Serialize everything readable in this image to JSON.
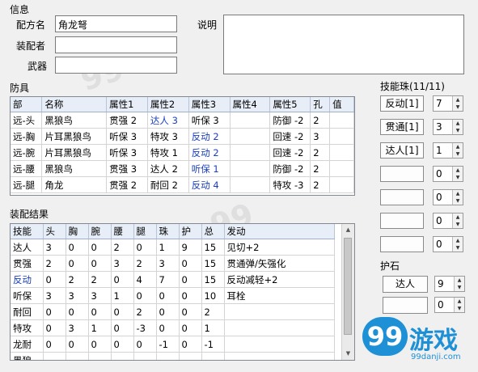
{
  "info": {
    "section_label": "信息",
    "recipe_name_label": "配方名",
    "recipe_name_value": "角龙弩",
    "assembler_label": "装配者",
    "assembler_value": "",
    "weapon_label": "武器",
    "weapon_value": "",
    "description_label": "说明",
    "description_value": ""
  },
  "armor": {
    "section_label": "防具",
    "columns": [
      "部",
      "名称",
      "属性1",
      "属性2",
      "属性3",
      "属性4",
      "属性5",
      "孔",
      "值"
    ],
    "rows": [
      [
        "远-头",
        "黑狼鸟",
        "贯强 2",
        "达人 3",
        "听保 3",
        "",
        "防御 -2",
        "2",
        ""
      ],
      [
        "远-胸",
        "片耳黑狼鸟",
        "听保 3",
        "特攻 3",
        "反动 2",
        "",
        "回速 -2",
        "3",
        ""
      ],
      [
        "远-腕",
        "片耳黑狼鸟",
        "听保 3",
        "特攻 1",
        "反动 2",
        "",
        "回速 -2",
        "2",
        ""
      ],
      [
        "远-腰",
        "黑狼鸟",
        "贯强 3",
        "达人 2",
        "听保 1",
        "",
        "防御 -2",
        "2",
        ""
      ],
      [
        "远-腿",
        "角龙",
        "贯强 2",
        "耐回 2",
        "反动 4",
        "",
        "特攻 -3",
        "2",
        ""
      ]
    ],
    "blue_cells": [
      [
        0,
        3
      ],
      [
        1,
        4
      ],
      [
        2,
        4
      ],
      [
        3,
        4
      ],
      [
        4,
        4
      ]
    ]
  },
  "result": {
    "section_label": "装配结果",
    "columns": [
      "技能",
      "头",
      "胸",
      "腕",
      "腰",
      "腿",
      "珠",
      "护",
      "总",
      "发动"
    ],
    "rows": [
      [
        "达人",
        "3",
        "0",
        "0",
        "2",
        "0",
        "1",
        "9",
        "15",
        "见切+2"
      ],
      [
        "贯强",
        "2",
        "0",
        "0",
        "3",
        "2",
        "3",
        "0",
        "15",
        "贯通弹/矢强化"
      ],
      [
        "反动",
        "0",
        "2",
        "2",
        "0",
        "4",
        "7",
        "0",
        "15",
        "反动减轻+2"
      ],
      [
        "听保",
        "3",
        "3",
        "3",
        "1",
        "0",
        "0",
        "0",
        "10",
        "耳栓"
      ],
      [
        "耐回",
        "0",
        "0",
        "0",
        "0",
        "2",
        "0",
        "0",
        "2",
        ""
      ],
      [
        "特攻",
        "0",
        "3",
        "1",
        "0",
        "-3",
        "0",
        "0",
        "1",
        ""
      ],
      [
        "龙耐",
        "0",
        "0",
        "0",
        "0",
        "0",
        "-1",
        "0",
        "-1",
        ""
      ],
      [
        "黑狼",
        "",
        "",
        "",
        "",
        "",
        "",
        "",
        "",
        ""
      ]
    ],
    "blue_rows": [
      2
    ]
  },
  "jewels": {
    "section_label": "技能珠(11/11)",
    "items": [
      {
        "label": "反动[1]",
        "count": "7"
      },
      {
        "label": "贯通[1]",
        "count": "3"
      },
      {
        "label": "达人[1]",
        "count": "1"
      },
      {
        "label": "",
        "count": "0"
      },
      {
        "label": "",
        "count": "0"
      },
      {
        "label": "",
        "count": "0"
      },
      {
        "label": "",
        "count": "0"
      }
    ]
  },
  "charm": {
    "section_label": "护石",
    "skill1_label": "达人",
    "skill1_count": "9",
    "skill2_label": "",
    "skill2_count": "0"
  },
  "watermark": {
    "logo_text": "游戏",
    "logo_number": "99",
    "logo_url": "99danji.com"
  },
  "colors": {
    "accent_blue": "#1a3fbf",
    "header_bg": "#e8eef7",
    "logo_blue": "#1e90d6"
  }
}
